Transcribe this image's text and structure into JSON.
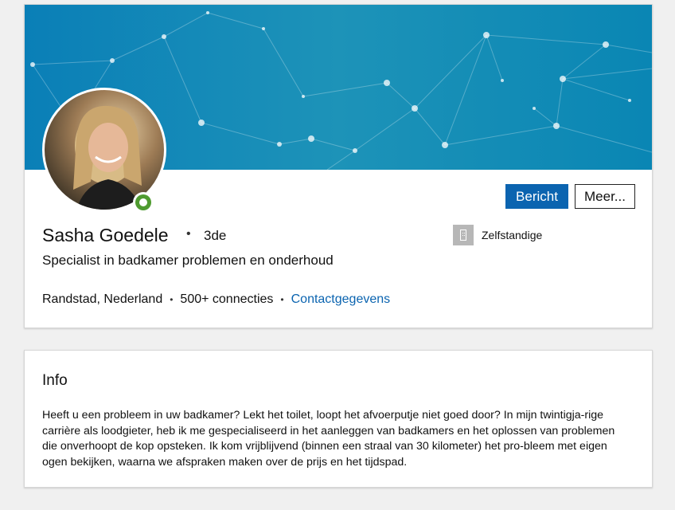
{
  "profile": {
    "name": "Sasha Goedele",
    "degree": "3de",
    "headline": "Specialist in badkamer problemen en onderhoud",
    "location": "Randstad, Nederland",
    "connections": "500+ connecties",
    "contact_link": "Contactgegevens",
    "company": "Zelfstandige",
    "online_status": "online",
    "avatar_icon": "profile-photo",
    "company_icon": "building-icon"
  },
  "actions": {
    "message_label": "Bericht",
    "more_label": "Meer..."
  },
  "info": {
    "title": "Info",
    "text": "Heeft u een probleem in uw badkamer? Lekt het toilet, loopt het afvoerputje niet goed door? In mijn twintigja-rige carrière als loodgieter, heb ik me gespecialiseerd in het aanleggen van badkamers en het oplossen van problemen die onverhoopt de kop opsteken. Ik kom vrijblijvend (binnen een straal van 30 kilometer) het pro-bleem met eigen ogen bekijken, waarna we afspraken maken over de prijs en het tijdspad."
  },
  "colors": {
    "accent": "#0b64b0",
    "banner": "#0a86b4",
    "online": "#4f9b30",
    "background": "#f0f0f0"
  }
}
